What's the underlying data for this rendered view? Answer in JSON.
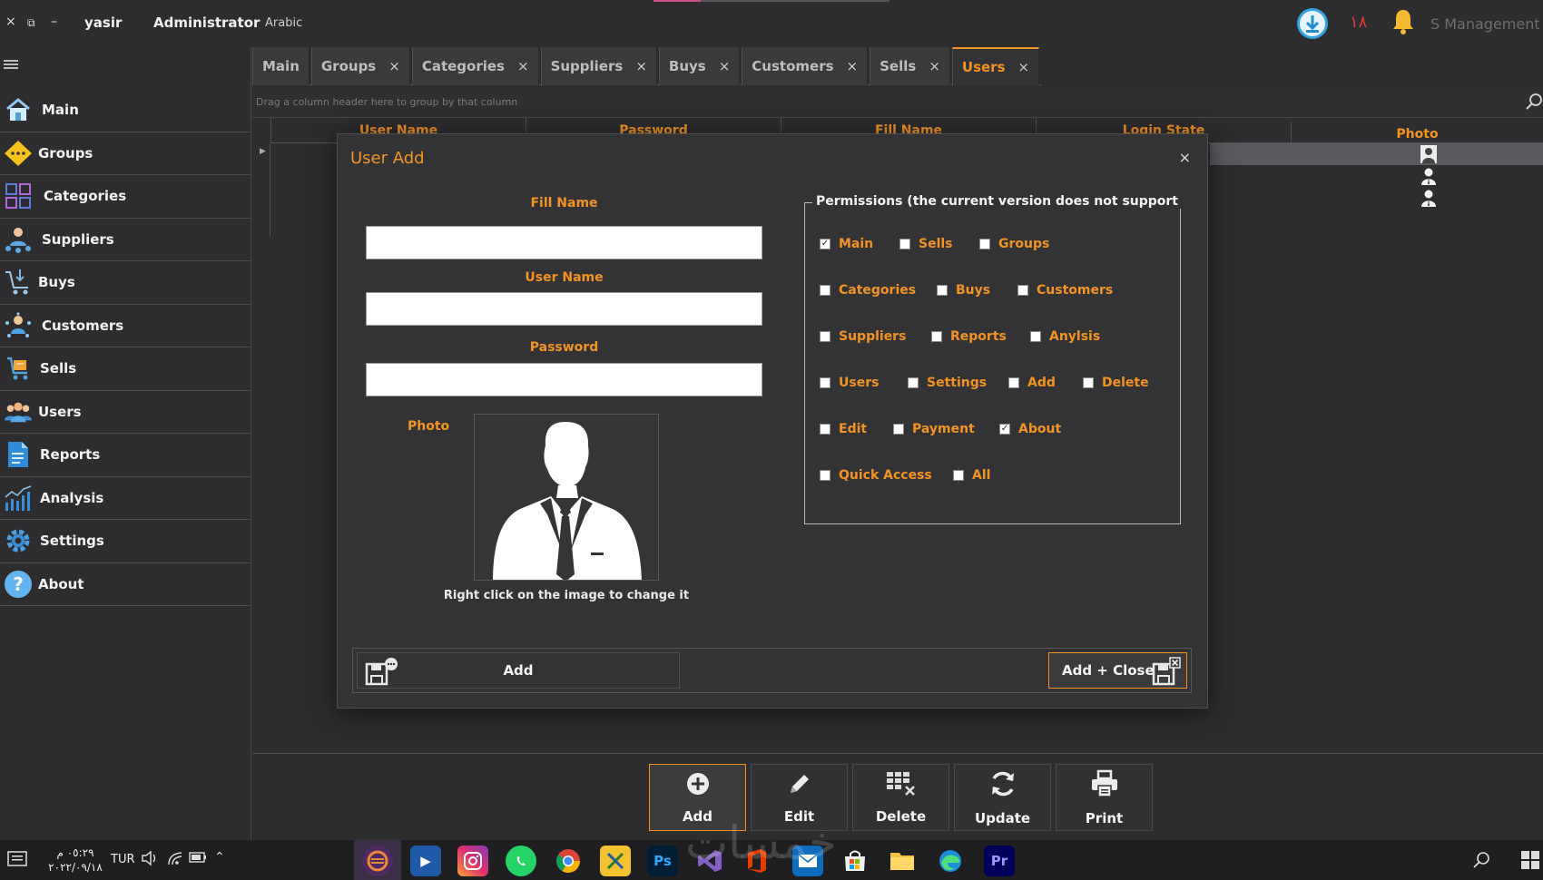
{
  "titlebar": {
    "close": "×",
    "restore": "⧉",
    "minimize": "–",
    "user": "yasir",
    "role": "Administrator",
    "language": "Arabic",
    "badge_count": "١٨",
    "app_title": "S Management"
  },
  "sidebar": {
    "items": [
      {
        "label": "Main",
        "icon": "home-icon"
      },
      {
        "label": "Groups",
        "icon": "groups-icon"
      },
      {
        "label": "Categories",
        "icon": "categories-icon"
      },
      {
        "label": "Suppliers",
        "icon": "suppliers-icon"
      },
      {
        "label": "Buys",
        "icon": "buys-icon"
      },
      {
        "label": "Customers",
        "icon": "customers-icon"
      },
      {
        "label": "Sells",
        "icon": "sells-icon"
      },
      {
        "label": "Users",
        "icon": "users-icon"
      },
      {
        "label": "Reports",
        "icon": "reports-icon"
      },
      {
        "label": "Analysis",
        "icon": "analysis-icon"
      },
      {
        "label": "Settings",
        "icon": "settings-icon"
      },
      {
        "label": "About",
        "icon": "about-icon"
      }
    ]
  },
  "tabs": [
    {
      "label": "Main"
    },
    {
      "label": "Groups"
    },
    {
      "label": "Categories"
    },
    {
      "label": "Suppliers"
    },
    {
      "label": "Buys"
    },
    {
      "label": "Customers"
    },
    {
      "label": "Sells"
    },
    {
      "label": "Users"
    }
  ],
  "grid": {
    "group_hint": "Drag a column header here to group by that column",
    "columns": [
      "User Name",
      "Password",
      "Fill Name",
      "Login State",
      "Photo"
    ]
  },
  "modal": {
    "title": "User Add",
    "close": "×",
    "fill_name_label": "Fill Name",
    "fill_name_value": "",
    "user_name_label": "User Name",
    "user_name_value": "",
    "password_label": "Password",
    "password_value": "",
    "photo_label": "Photo",
    "photo_hint": "Right click on the image to change it",
    "permissions_legend": "Permissions (the current version does not support",
    "permissions": [
      {
        "label": "Main",
        "checked": true
      },
      {
        "label": "Sells",
        "checked": false
      },
      {
        "label": "Groups",
        "checked": false
      },
      {
        "label": "Categories",
        "checked": false
      },
      {
        "label": "Buys",
        "checked": false
      },
      {
        "label": "Customers",
        "checked": false
      },
      {
        "label": "Suppliers",
        "checked": false
      },
      {
        "label": "Reports",
        "checked": false
      },
      {
        "label": "Anylsis",
        "checked": false
      },
      {
        "label": "Users",
        "checked": false
      },
      {
        "label": "Settings",
        "checked": false
      },
      {
        "label": "Add",
        "checked": false
      },
      {
        "label": "Delete",
        "checked": false
      },
      {
        "label": "Edit",
        "checked": false
      },
      {
        "label": "Payment",
        "checked": false
      },
      {
        "label": "About",
        "checked": true
      },
      {
        "label": "Quick Access",
        "checked": false
      },
      {
        "label": "All",
        "checked": false
      }
    ],
    "add_label": "Add",
    "add_close_label": "Add + Close"
  },
  "toolbar": {
    "buttons": [
      {
        "label": "Add",
        "icon": "plus-icon"
      },
      {
        "label": "Edit",
        "icon": "pencil-icon"
      },
      {
        "label": "Delete",
        "icon": "delete-icon"
      },
      {
        "label": "Update",
        "icon": "refresh-icon"
      },
      {
        "label": "Print",
        "icon": "printer-icon"
      }
    ]
  },
  "taskbar": {
    "time": "٠٥:٢٩ م",
    "date": "٢٠٢٢/٠٩/١٨",
    "lang": "TUR",
    "watermark": "خمسات"
  },
  "colors": {
    "accent": "#f39322",
    "background": "#2d2d30",
    "dialog": "#333336"
  }
}
